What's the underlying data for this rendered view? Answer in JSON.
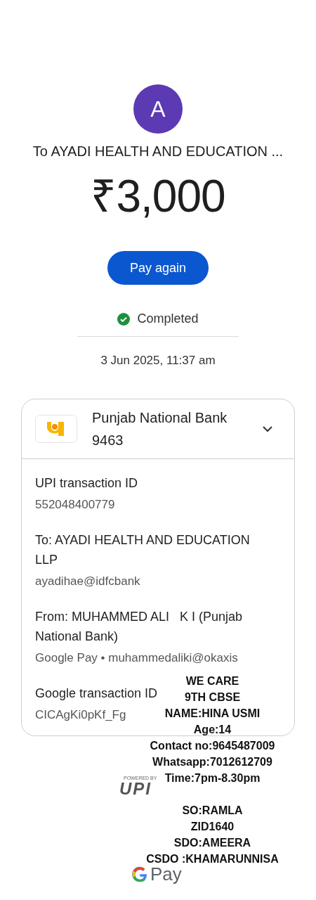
{
  "payee": {
    "avatar_letter": "A",
    "title": "To AYADI HEALTH AND EDUCATION ..."
  },
  "amount": "₹3,000",
  "pay_again_button": "Pay again",
  "status": {
    "label": "Completed",
    "kind": "success"
  },
  "date": "3 Jun 2025, 11:37 am",
  "details_card": {
    "bank_name": "Punjab National Bank",
    "account_digits": "9463",
    "sections": [
      {
        "heading": "UPI transaction ID",
        "lines": [
          "552048400779"
        ]
      },
      {
        "heading": "To: AYADI HEALTH AND EDUCATION LLP",
        "lines": [
          "ayadihae@idfcbank"
        ]
      },
      {
        "heading": "From: MUHAMMED ALI   K I (Punjab National Bank)",
        "lines": [
          "Google Pay • muhammedaliki@okaxis"
        ]
      },
      {
        "heading": "Google transaction ID",
        "lines": [
          "CICAgKi0pKf_Fg"
        ]
      }
    ]
  },
  "footer": {
    "powered_by": "POWERED BY",
    "upi_logo": "UPI",
    "gpay_logo": "Pay"
  },
  "overlay_note": {
    "blocks": [
      [
        "WE CARE",
        "9TH CBSE",
        "NAME:HINA USMI",
        "Age:14",
        "Contact no:9645487009",
        "Whatsapp:7012612709",
        "Time:7pm-8.30pm"
      ],
      [
        "SO:RAMLA",
        "ZID1640",
        "SDO:AMEERA",
        "CSDO :KHAMARUNNISA"
      ]
    ]
  }
}
